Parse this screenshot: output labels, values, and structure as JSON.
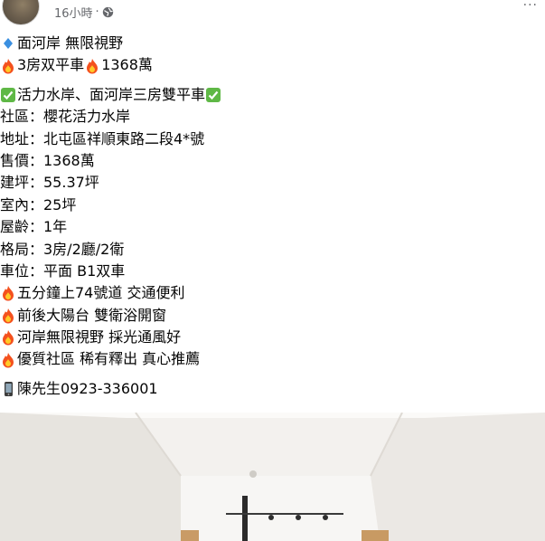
{
  "header": {
    "time": "16小時",
    "separator": "·",
    "privacy_icon": "globe-icon",
    "more_icon": "more-dots-icon"
  },
  "post": {
    "lines": [
      {
        "icon": "blue-diamond-icon",
        "text": "面河岸 無限視野"
      },
      {
        "icon": "fire-icon",
        "text": "3房双平車"
      },
      {
        "icon": "check-icon",
        "text": "活力水岸、面河岸三房雙平車"
      },
      {
        "text": "社區：櫻花活力水岸"
      },
      {
        "text": "地址：北屯區祥順東路二段4*號"
      },
      {
        "text": "售價：1368萬"
      },
      {
        "text": "建坪：55.37坪"
      },
      {
        "text": "室內：25坪"
      },
      {
        "text": "屋齡：1年"
      },
      {
        "text": "格局：3房/2廳/2衛"
      },
      {
        "text": "車位：平面 B1双車"
      },
      {
        "icon": "fire-icon",
        "text": "五分鐘上74號道 交通便利"
      },
      {
        "icon": "fire-icon",
        "text": "前後大陽台 雙衛浴開窗"
      },
      {
        "icon": "fire-icon",
        "text": "河岸無限視野 採光通風好"
      },
      {
        "icon": "fire-icon",
        "text": "優質社區 稀有釋出 真心推薦"
      },
      {
        "icon": "phone-icon",
        "text": "陳先生0923-336001"
      }
    ],
    "line2_second": "1368萬"
  },
  "photo": {
    "alt_icon": "interior-photo"
  }
}
